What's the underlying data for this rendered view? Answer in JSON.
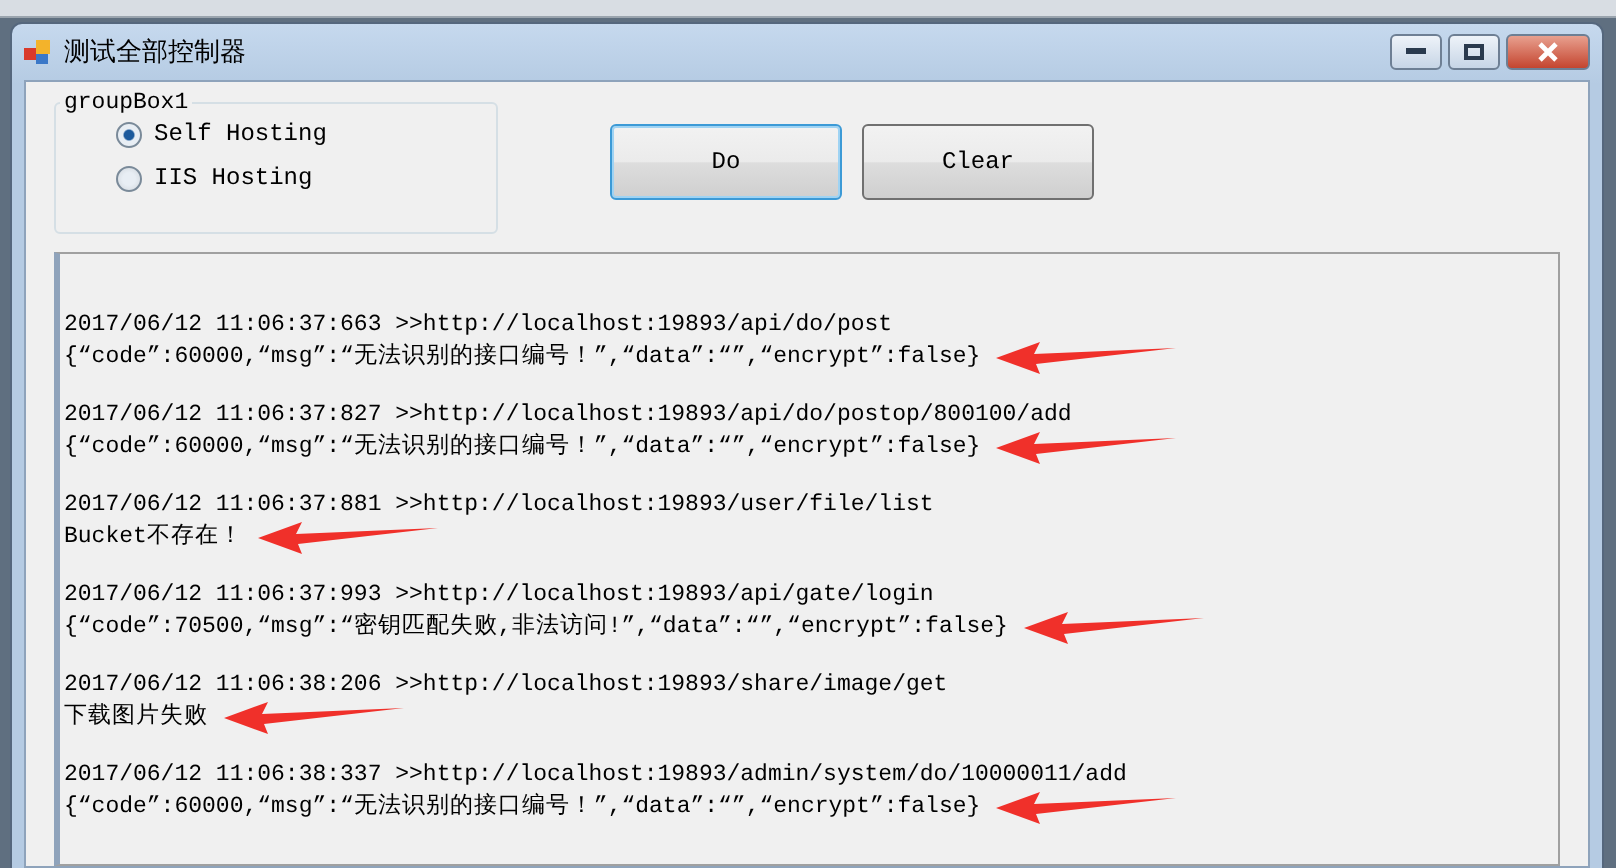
{
  "window": {
    "title": "测试全部控制器"
  },
  "group_box": {
    "title": "groupBox1",
    "options": [
      {
        "label": "Self Hosting",
        "selected": true
      },
      {
        "label": "IIS Hosting",
        "selected": false
      }
    ]
  },
  "buttons": [
    {
      "label": "Do",
      "focused": true
    },
    {
      "label": "Clear",
      "focused": false
    }
  ],
  "log": [
    {
      "request": "2017/06/12 11:06:37:663 >>http://localhost:19893/api/do/post",
      "response": "{“code”:60000,“msg”:“无法识别的接口编号！”,“data”:“”,“encrypt”:false}",
      "marked": true
    },
    {
      "request": "2017/06/12 11:06:37:827 >>http://localhost:19893/api/do/postop/800100/add",
      "response": "{“code”:60000,“msg”:“无法识别的接口编号！”,“data”:“”,“encrypt”:false}",
      "marked": true
    },
    {
      "request": "2017/06/12 11:06:37:881 >>http://localhost:19893/user/file/list",
      "response": "Bucket不存在！",
      "marked": true
    },
    {
      "request": "2017/06/12 11:06:37:993 >>http://localhost:19893/api/gate/login",
      "response": "{“code”:70500,“msg”:“密钥匹配失败,非法访问!”,“data”:“”,“encrypt”:false}",
      "marked": true
    },
    {
      "request": "2017/06/12 11:06:38:206 >>http://localhost:19893/share/image/get",
      "response": "下载图片失败",
      "marked": true
    },
    {
      "request": "2017/06/12 11:06:38:337 >>http://localhost:19893/admin/system/do/10000011/add",
      "response": "{“code”:60000,“msg”:“无法识别的接口编号！”,“data”:“”,“encrypt”:false}",
      "marked": true
    }
  ]
}
